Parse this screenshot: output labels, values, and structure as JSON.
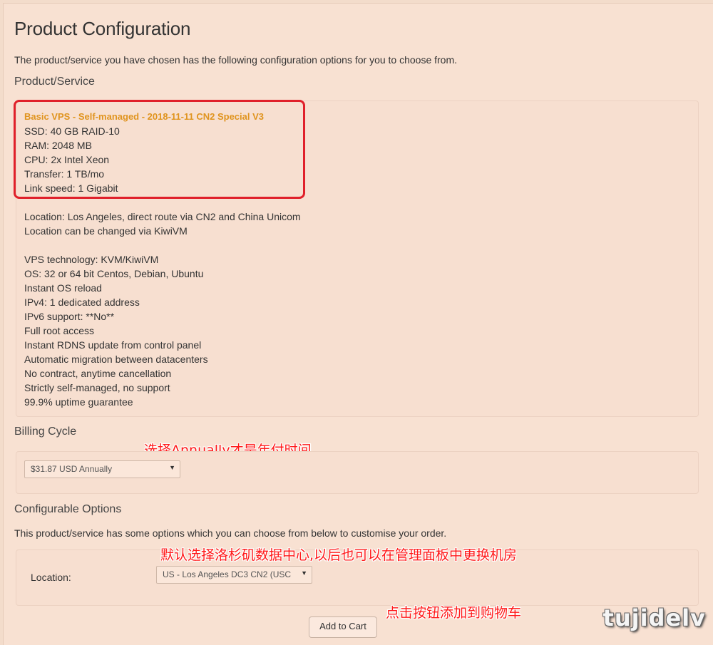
{
  "page": {
    "title": "Product Configuration",
    "intro": "The product/service you have chosen has the following configuration options for you to choose from."
  },
  "product": {
    "heading": "Product/Service",
    "name": "Basic VPS - Self-managed - 2018-11-11 CN2 Special V3",
    "specs": [
      "SSD: 40 GB RAID-10",
      "RAM: 2048 MB",
      "CPU: 2x Intel Xeon",
      "Transfer: 1 TB/mo",
      "Link speed: 1 Gigabit"
    ],
    "location_lines": [
      "Location: Los Angeles, direct route via CN2 and China Unicom",
      "Location can be changed via KiwiVM"
    ],
    "features": [
      "VPS technology: KVM/KiwiVM",
      "OS: 32 or 64 bit Centos, Debian, Ubuntu",
      "Instant OS reload",
      "IPv4: 1 dedicated address",
      "IPv6 support: **No**",
      "Full root access",
      "Instant RDNS update from control panel",
      "Automatic migration between datacenters",
      "No contract, anytime cancellation",
      "Strictly self-managed, no support",
      "99.9% uptime guarantee"
    ]
  },
  "billing": {
    "heading": "Billing Cycle",
    "selected": "$31.87 USD Annually"
  },
  "options": {
    "heading": "Configurable Options",
    "intro": "This product/service has some options which you can choose from below to customise your order.",
    "location_label": "Location:",
    "location_selected": "US - Los Angeles DC3 CN2 (USC"
  },
  "actions": {
    "add_to_cart": "Add to Cart"
  },
  "annotations": {
    "billing": "选择Annually才是年付时间",
    "location": "默认选择洛杉矶数据中心,以后也可以在管理面板中更换机房",
    "cart": "点击按钮添加到购物车",
    "color": "#ff1a1a"
  },
  "watermark": "tujidelv",
  "colors": {
    "background": "#f8e1d2",
    "product_name": "#e0941f",
    "highlight": "#e0202a"
  }
}
